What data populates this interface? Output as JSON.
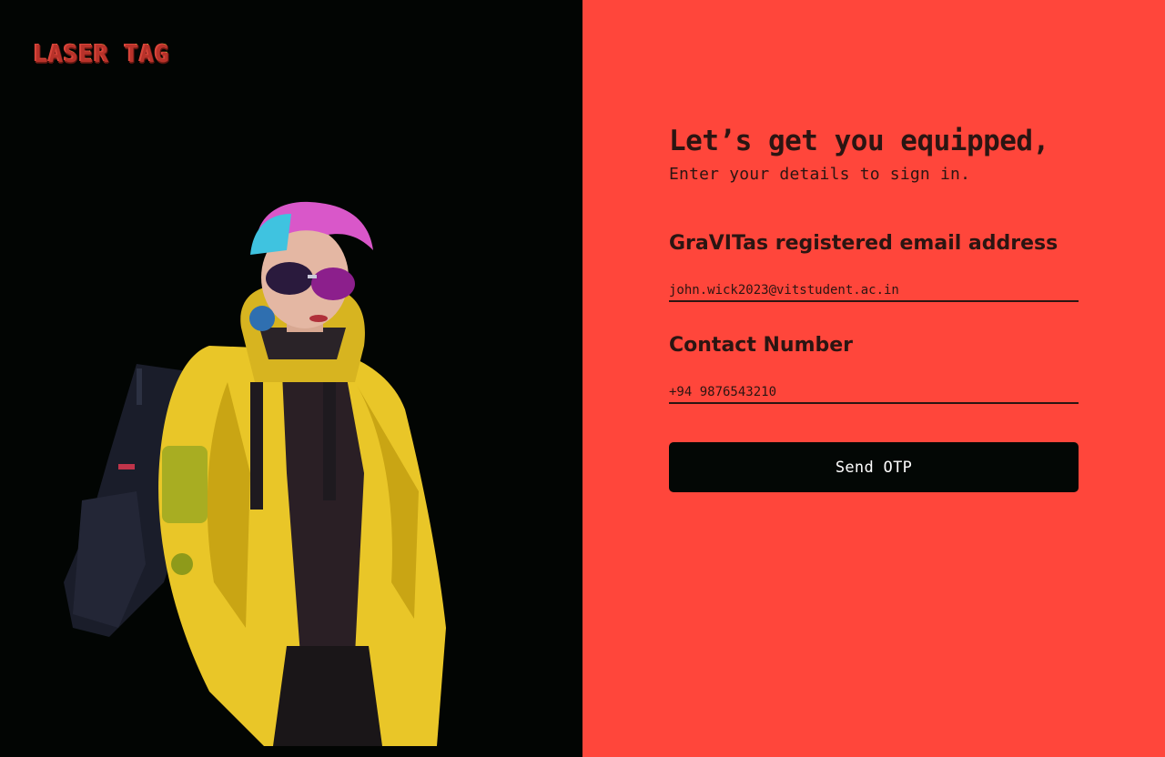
{
  "brand": {
    "logo_text": "LASER TAG"
  },
  "hero": {
    "icon": "cyberpunk-character-illustration"
  },
  "form": {
    "title": "Let’s get you equipped,",
    "subtitle": "Enter your details to sign in.",
    "email_label": "GraVITas registered email address",
    "email_placeholder": "john.wick2023@vitstudent.ac.in",
    "phone_label": "Contact Number",
    "phone_placeholder": "+94 9876543210",
    "submit_label": "Send OTP"
  },
  "colors": {
    "left_bg": "#020503",
    "right_bg": "#ff463b",
    "text_dark": "#2b1512",
    "button_bg": "#030705",
    "button_text": "#ffffff"
  }
}
